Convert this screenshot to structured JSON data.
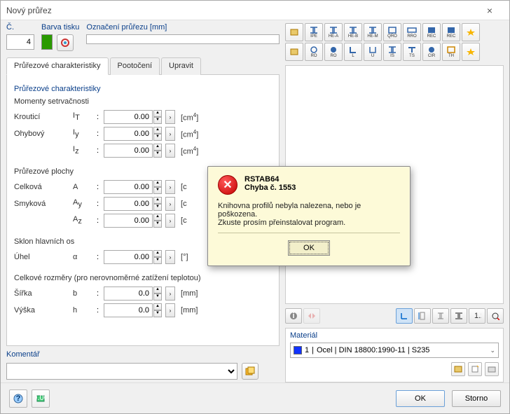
{
  "window": {
    "title": "Nový průřez"
  },
  "top": {
    "number_label": "Č.",
    "number_value": "4",
    "color_label": "Barva tisku",
    "desc_label": "Označení průřezu [mm]",
    "desc_value": ""
  },
  "tabs": {
    "t0": "Průřezové charakteristiky",
    "t1": "Pootočení",
    "t2": "Upravit"
  },
  "groups": {
    "chars": "Průřezové charakteristiky",
    "moments": "Momenty setrvačnosti",
    "areas": "Průřezové plochy",
    "incl": "Sklon hlavních os",
    "dims": "Celkové rozměry (pro nerovnoměrné zatížení teplotou)",
    "comment": "Komentář"
  },
  "rows": {
    "torsion": {
      "label": "Krouticí",
      "sym": "I",
      "sub": "T",
      "value": "0.00",
      "unit_base": "cm",
      "unit_exp": "4"
    },
    "bend_y": {
      "label": "Ohybový",
      "sym": "I",
      "sub": "y",
      "value": "0.00",
      "unit_base": "cm",
      "unit_exp": "4"
    },
    "bend_z": {
      "label": "",
      "sym": "I",
      "sub": "z",
      "value": "0.00",
      "unit_base": "cm",
      "unit_exp": "4"
    },
    "area_a": {
      "label": "Celková",
      "sym": "A",
      "sub": "",
      "value": "0.00",
      "unit_cut": "c"
    },
    "area_ay": {
      "label": "Smyková",
      "sym": "A",
      "sub": "y",
      "value": "0.00",
      "unit_cut": "c"
    },
    "area_az": {
      "label": "",
      "sym": "A",
      "sub": "z",
      "value": "0.00",
      "unit_cut": "c"
    },
    "angle": {
      "label": "Úhel",
      "sym": "α",
      "sub": "",
      "value": "0.00",
      "unit_plain": "°"
    },
    "width": {
      "label": "Šířka",
      "sym": "b",
      "sub": "",
      "value": "0.0",
      "unit_plain": "mm"
    },
    "height": {
      "label": "Výška",
      "sym": "h",
      "sub": "",
      "value": "0.0",
      "unit_plain": "mm"
    }
  },
  "profiles": {
    "r1": [
      "",
      "IPE",
      "HE-A",
      "HE-B",
      "HE-M",
      "QRO",
      "RRO",
      "REC",
      "REC",
      ""
    ],
    "r2": [
      "",
      "RO",
      "RO",
      "L",
      "U",
      "IS",
      "TS",
      "CIR",
      "TH",
      ""
    ]
  },
  "material": {
    "title": "Materiál",
    "index": "1",
    "text": "Ocel | DIN 18800:1990-11 | S235"
  },
  "buttons": {
    "ok": "OK",
    "cancel": "Storno"
  },
  "error": {
    "title1": "RSTAB64",
    "title2": "Chyba č. 1553",
    "line1": "Knihovna profilů nebyla nalezena, nebo je poškozena.",
    "line2": "Zkuste prosím přeinstalovat program.",
    "ok": "OK"
  }
}
